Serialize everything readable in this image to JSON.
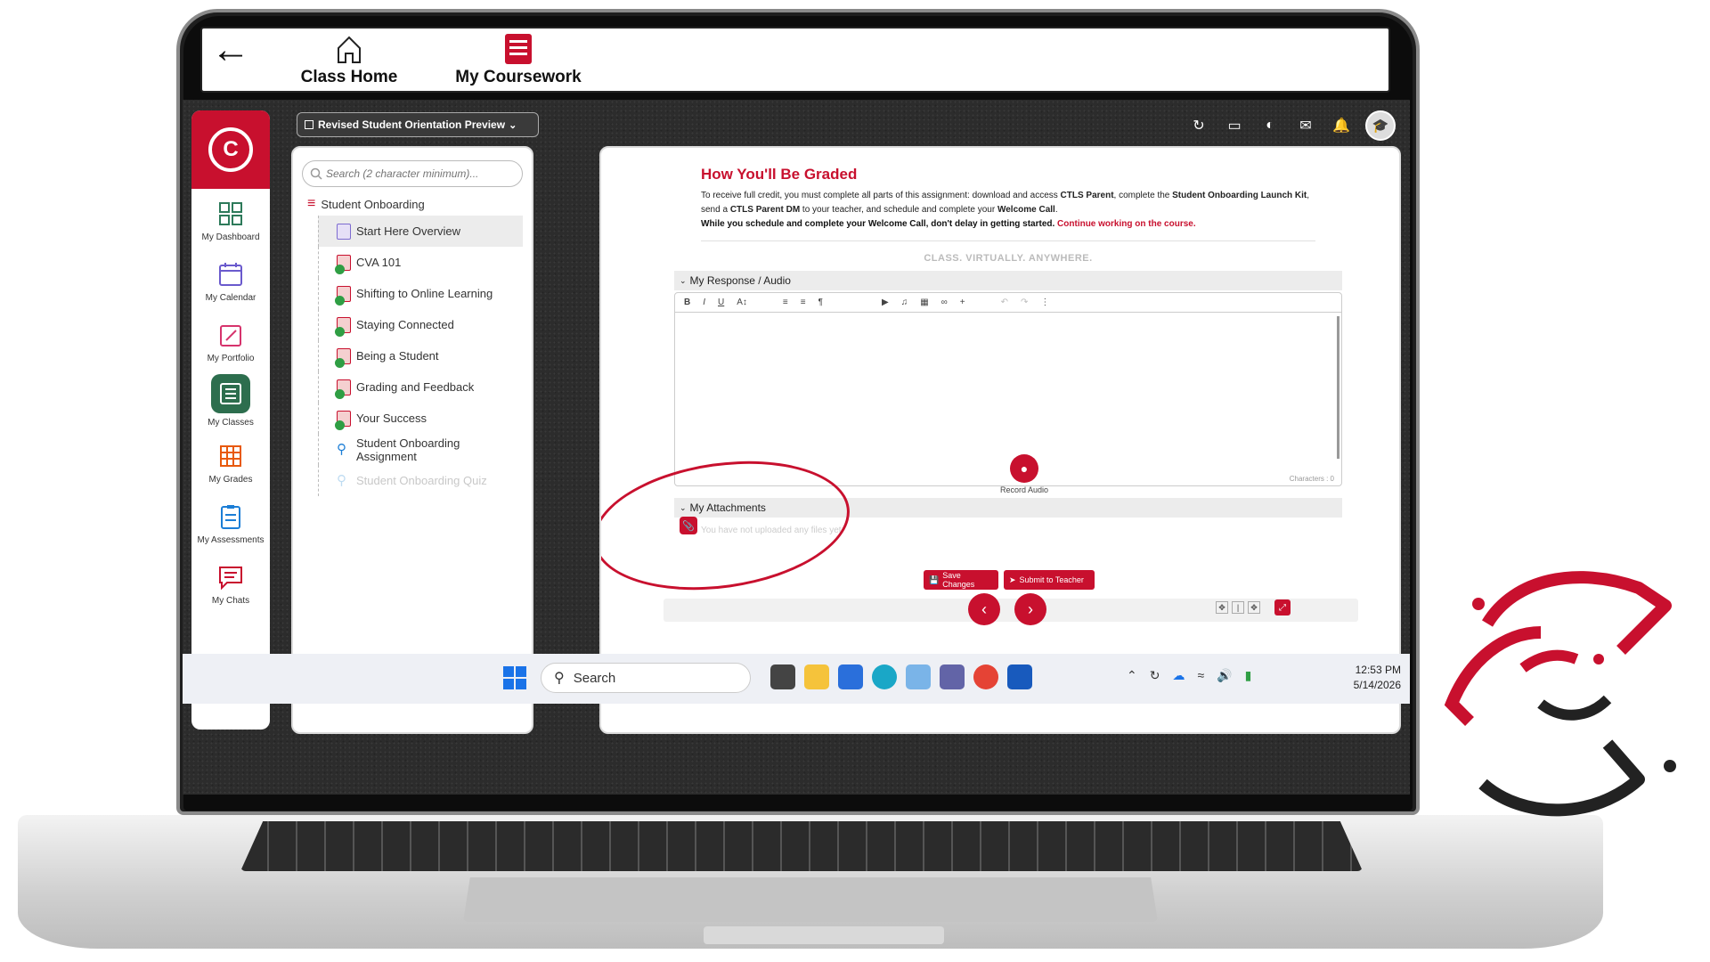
{
  "header": {
    "nav": [
      {
        "label": "Class Home",
        "icon": "home-icon"
      },
      {
        "label": "My Coursework",
        "icon": "coursework-icon"
      }
    ]
  },
  "sidebar": {
    "items": [
      {
        "label": "My Dashboard",
        "icon": "dashboard-icon"
      },
      {
        "label": "My Calendar",
        "icon": "calendar-icon"
      },
      {
        "label": "My Portfolio",
        "icon": "portfolio-icon"
      },
      {
        "label": "My Classes",
        "icon": "classes-icon"
      },
      {
        "label": "My Grades",
        "icon": "grades-icon"
      },
      {
        "label": "My Assessments",
        "icon": "assessments-icon"
      },
      {
        "label": "My Chats",
        "icon": "chats-icon"
      }
    ],
    "active": "My Classes"
  },
  "course": {
    "selected": "Revised Student Orientation Preview"
  },
  "outline": {
    "search_placeholder": "Search (2 character minimum)...",
    "module": "Student Onboarding",
    "items": [
      {
        "label": "Start Here Overview",
        "state": "selected"
      },
      {
        "label": "CVA 101",
        "state": "complete"
      },
      {
        "label": "Shifting to Online Learning",
        "state": "complete"
      },
      {
        "label": "Staying Connected",
        "state": "complete"
      },
      {
        "label": "Being a Student",
        "state": "complete"
      },
      {
        "label": "Grading and Feedback",
        "state": "complete"
      },
      {
        "label": "Your Success",
        "state": "complete"
      },
      {
        "label": "Student Onboarding Assignment",
        "state": "assignment"
      },
      {
        "label": "Student Onboarding Quiz",
        "state": "disabled"
      }
    ]
  },
  "content": {
    "title": "How You'll Be Graded",
    "para1_a": "To receive full credit, you must complete all parts of this assignment: download and access ",
    "para1_b": "CTLS Parent",
    "para1_c": ", complete the ",
    "para1_d": "Student Onboarding Launch Kit",
    "para1_e": ", send a ",
    "para1_f": "CTLS Parent DM",
    "para1_g": " to your teacher, and schedule and complete your ",
    "para1_h": "Welcome Call",
    "para1_i": ".",
    "para2": "While you schedule and complete your Welcome Call, don't delay in getting started.",
    "para2_link": "Continue working on the course.",
    "tagline": "CLASS. VIRTUALLY. ANYWHERE."
  },
  "response": {
    "section_label": "My Response / Audio",
    "char_count": "Characters : 0",
    "record_label": "Record Audio"
  },
  "attachments": {
    "section_label": "My Attachments",
    "empty_text": "You have not uploaded any files yet."
  },
  "actions": {
    "save_label": "Save Changes",
    "submit_label": "Submit to Teacher"
  },
  "taskbar": {
    "search_label": "Search",
    "time": "12:53 PM",
    "date": "5/14/2026"
  },
  "colors": {
    "brand_red": "#c8102e",
    "active_green": "#2d6e4e"
  }
}
